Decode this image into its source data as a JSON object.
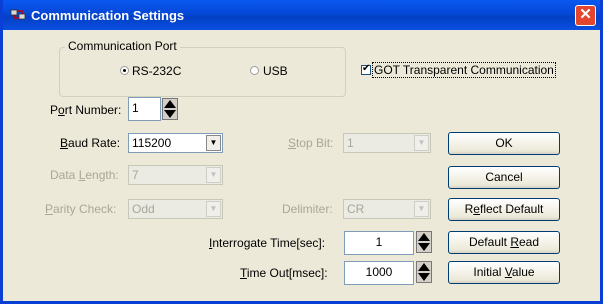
{
  "title": "Communication Settings",
  "close_symbol": "✕",
  "icons": {
    "app": "app-icon",
    "close": "close-icon"
  },
  "colors": {
    "titlebar": "#0548d8",
    "close": "#e3462d",
    "dialog_bg": "#ece9d8"
  },
  "comm_port": {
    "group_label": "Communication Port",
    "rs232c": {
      "label": "RS-232C",
      "selected": true
    },
    "usb": {
      "label": "USB",
      "selected": false
    }
  },
  "got_transparent": {
    "label": "GOT Transparent Communication",
    "checked": true
  },
  "port_number": {
    "label_pre": "P",
    "label_ul": "o",
    "label_post": "rt Number:",
    "value": "1"
  },
  "baud_rate": {
    "label_ul": "B",
    "label_post": "aud Rate:",
    "value": "115200"
  },
  "data_length": {
    "label_pre": "Data ",
    "label_ul": "L",
    "label_post": "ength:",
    "value": "7"
  },
  "parity_check": {
    "label_ul": "P",
    "label_post": "arity Check:",
    "value": "Odd"
  },
  "stop_bit": {
    "label_pre": "",
    "label_ul": "S",
    "label_post": "top Bit:",
    "value": "1"
  },
  "delimiter": {
    "label_pre": "Delimiter:",
    "value": "CR"
  },
  "interrogate_time": {
    "label_ul": "I",
    "label_post": "nterrogate Time[sec]:",
    "value": "1"
  },
  "time_out": {
    "label_ul": "T",
    "label_post": "ime Out[msec]:",
    "value": "1000"
  },
  "buttons": {
    "ok": "OK",
    "cancel": "Cancel",
    "reflect_default": {
      "pre": "R",
      "ul": "e",
      "post": "flect Default"
    },
    "default_read": {
      "pre": "Default ",
      "ul": "R",
      "post": "ead"
    },
    "initial_value": {
      "pre": "Initial ",
      "ul": "V",
      "post": "alue"
    }
  }
}
